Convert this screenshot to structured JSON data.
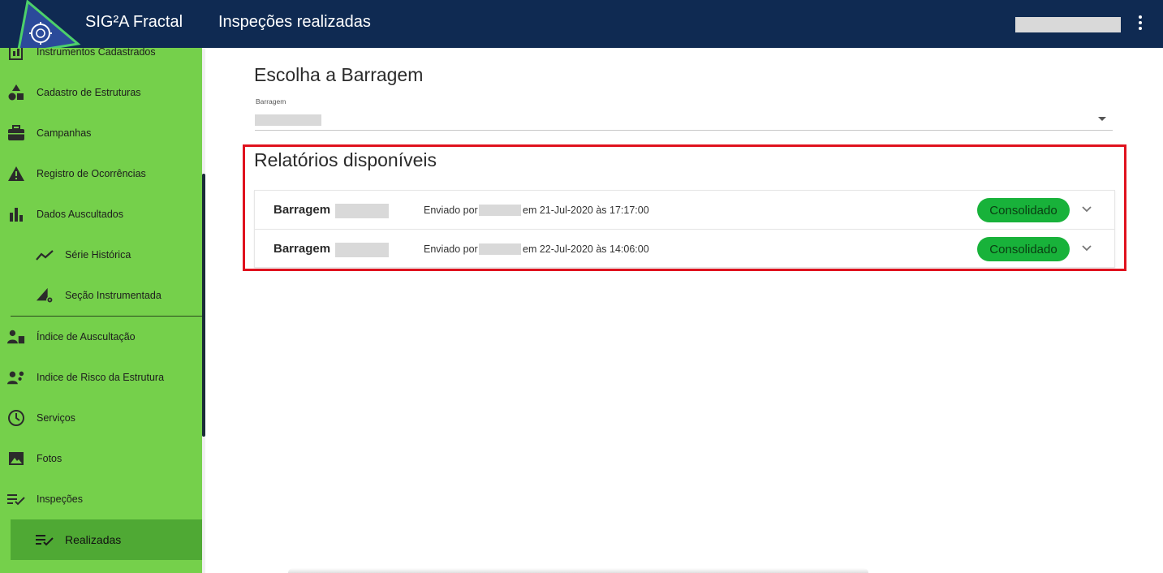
{
  "header": {
    "app_title": "SIG²A Fractal",
    "page_title": "Inspeções realizadas",
    "bg_color": "#0f2a52"
  },
  "sidebar": {
    "bg_color": "#75d04b",
    "active_color": "#4fa934",
    "items": [
      {
        "label": "Instrumentos Cadastrados",
        "icon": "clipboard-icon"
      },
      {
        "label": "Cadastro de Estruturas",
        "icon": "shapes-icon"
      },
      {
        "label": "Campanhas",
        "icon": "briefcase-icon"
      },
      {
        "label": "Registro de Ocorrências",
        "icon": "warning-icon"
      },
      {
        "label": "Dados Auscultados",
        "icon": "bar-chart-icon"
      },
      {
        "label": "Série Histórica",
        "icon": "trending-line-icon"
      },
      {
        "label": "Seção Instrumentada",
        "icon": "section-gear-icon"
      },
      {
        "label": "Índice de Auscultação",
        "icon": "worker-clipboard-icon"
      },
      {
        "label": "Indice de Risco da Estrutura",
        "icon": "worker-gear-icon"
      },
      {
        "label": "Serviços",
        "icon": "clock-icon"
      },
      {
        "label": "Fotos",
        "icon": "image-icon"
      },
      {
        "label": "Inspeções",
        "icon": "list-check-icon"
      },
      {
        "label": "Realizadas",
        "icon": "list-check-icon"
      }
    ]
  },
  "main": {
    "choose_title": "Escolha a Barragem",
    "select_label": "Barragem",
    "reports_title": "Relatórios disponíveis",
    "reports": [
      {
        "name": "Barragem",
        "sent_prefix": "Enviado por",
        "sent_suffix": "em 21-Jul-2020 às 17:17:00",
        "status": "Consolidado"
      },
      {
        "name": "Barragem",
        "sent_prefix": "Enviado por",
        "sent_suffix": "em 22-Jul-2020 às 14:06:00",
        "status": "Consolidado"
      }
    ],
    "status_color": "#18b23a",
    "highlight_color": "#e0121e"
  }
}
